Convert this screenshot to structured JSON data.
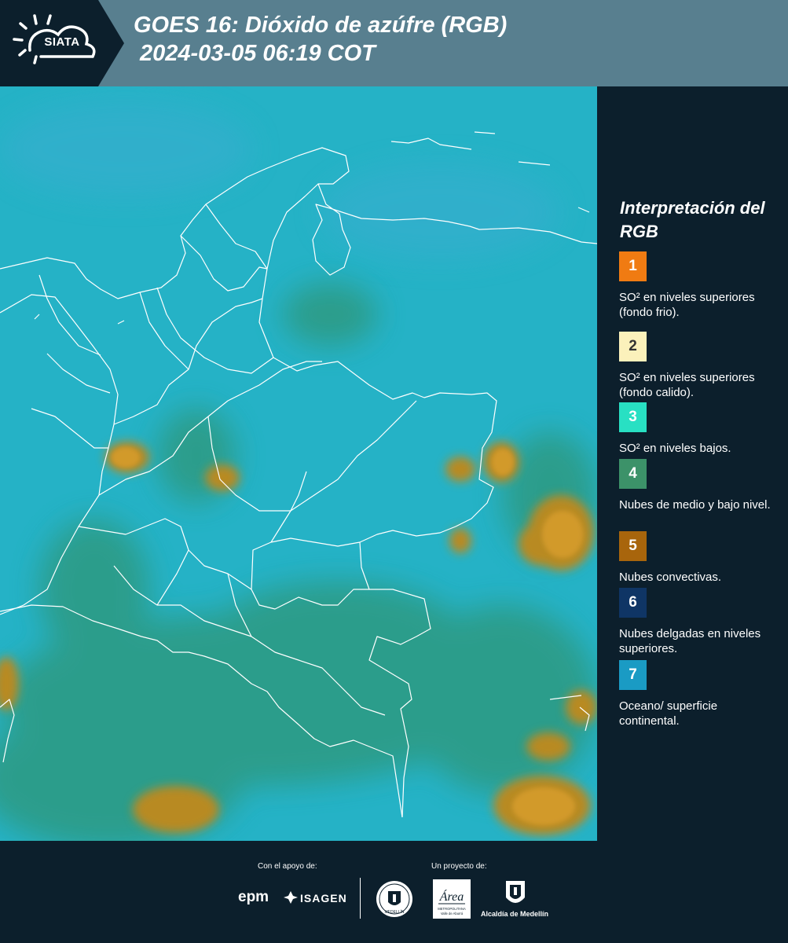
{
  "header": {
    "logo_text": "SIATA",
    "title_line1": "GOES 16: Dióxido de azúfre (RGB)",
    "title_line2": "2024-03-05 06:19 COT"
  },
  "legend": {
    "title": "Interpretación del RGB",
    "items": [
      {
        "number": "1",
        "label": "SO² en niveles superiores (fondo frio).",
        "color": "#f07b12"
      },
      {
        "number": "2",
        "label": "SO² en niveles superiores (fondo calido).",
        "color": "#fbf1bb"
      },
      {
        "number": "3",
        "label": "SO² en niveles bajos.",
        "color": "#28e0c3"
      },
      {
        "number": "4",
        "label": "Nubes de medio y bajo nivel.",
        "color": "#3c9269"
      },
      {
        "number": "5",
        "label": "Nubes convectivas.",
        "color": "#a8650c"
      },
      {
        "number": "6",
        "label": "Nubes delgadas en niveles superiores.",
        "color": "#0f3565"
      },
      {
        "number": "7",
        "label": "Oceano/ superficie continental.",
        "color": "#1a9bc4"
      }
    ]
  },
  "map": {
    "background_color": "#25b2c6",
    "vegetation_color": "#2f9678",
    "convective_color": "#b88a21",
    "border_color": "#ffffff"
  },
  "footer": {
    "support_label": "Con el apoyo de:",
    "project_label": "Un proyecto de:",
    "sponsor_1": "epm",
    "sponsor_2": "ISAGEN",
    "partner_1": "MEDELLÍN",
    "partner_2_name": "Área",
    "partner_2_sub": "METROPOLITANA Valle de Aburrá",
    "partner_3": "Alcaldía de Medellín"
  }
}
